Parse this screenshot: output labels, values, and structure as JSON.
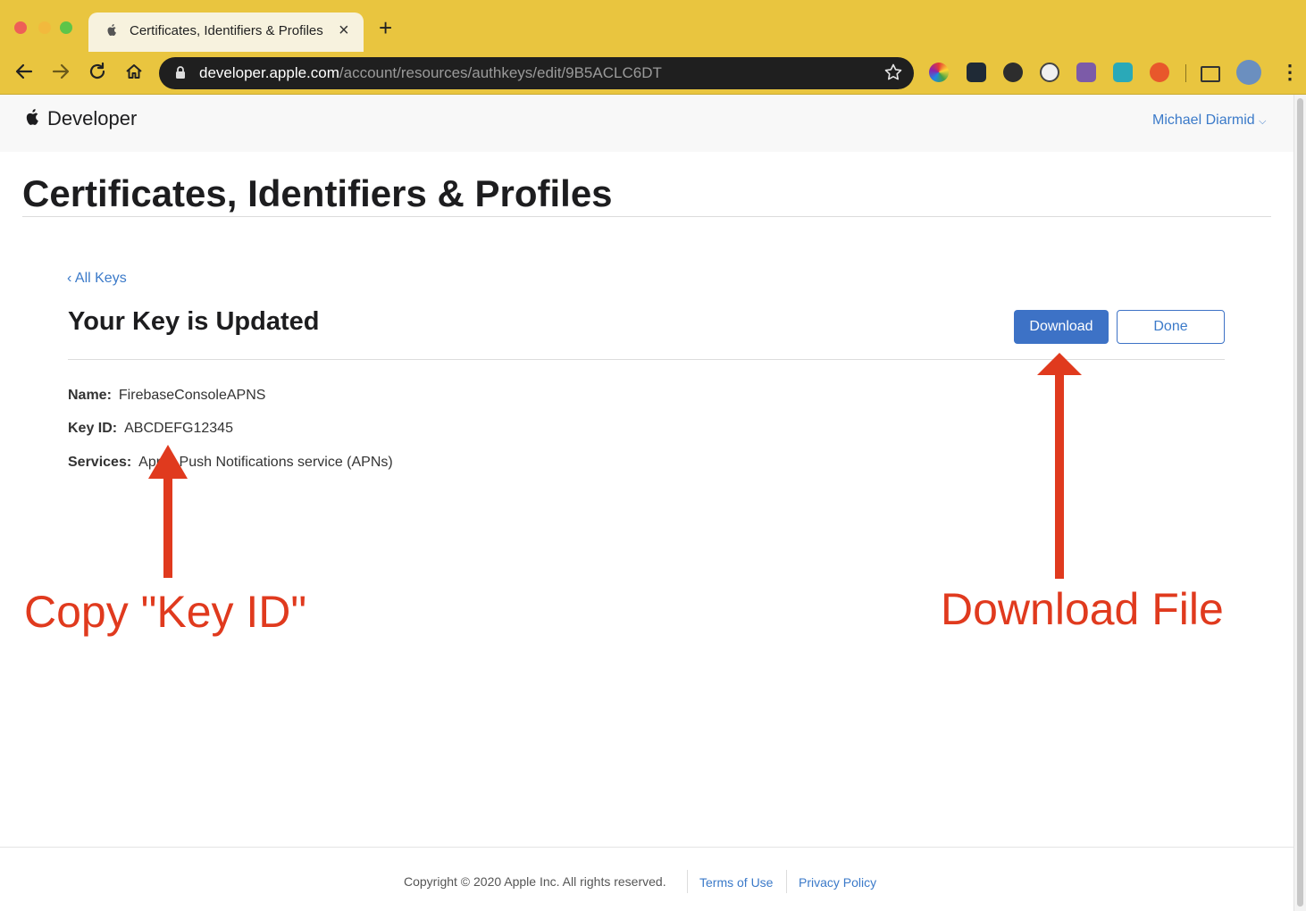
{
  "browser": {
    "tab_title": "Certificates, Identifiers & Profiles",
    "url_host": "developer.apple.com",
    "url_path": "/account/resources/authkeys/edit/9B5ACLC6DT"
  },
  "header": {
    "brand": "Developer",
    "user_name": "Michael Diarmid"
  },
  "page": {
    "title": "Certificates, Identifiers & Profiles",
    "back_link": "‹ All Keys",
    "section_title": "Your Key is Updated",
    "download_label": "Download",
    "done_label": "Done",
    "details": {
      "name_label": "Name:",
      "name_value": "FirebaseConsoleAPNS",
      "keyid_label": "Key ID:",
      "keyid_value": "ABCDEFG12345",
      "services_label": "Services:",
      "services_value": "Apple Push Notifications service (APNs)"
    }
  },
  "footer": {
    "copyright": "Copyright © 2020 Apple Inc. All rights reserved.",
    "terms": "Terms of Use",
    "privacy": "Privacy Policy"
  },
  "annotations": {
    "copy_key": "Copy \"Key ID\"",
    "download_file": "Download File",
    "color": "#e03a1e"
  },
  "colors": {
    "chrome": "#e9c53f",
    "accent": "#3d72c6",
    "link": "#3b7ac9"
  }
}
